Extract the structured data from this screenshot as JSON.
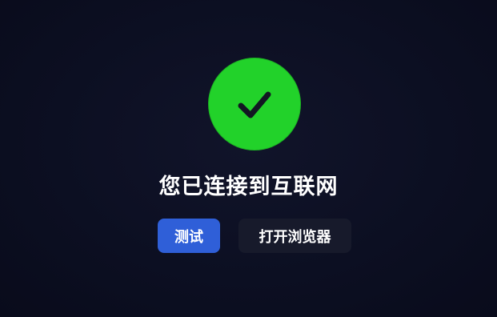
{
  "status": {
    "icon": "check-icon",
    "title": "您已连接到互联网"
  },
  "actions": {
    "test_label": "测试",
    "open_browser_label": "打开浏览器"
  },
  "colors": {
    "background": "#0c0f22",
    "success": "#22d22a",
    "check_mark": "#121722",
    "primary_button": "#2f5fd8",
    "secondary_button": "#171a2b"
  }
}
